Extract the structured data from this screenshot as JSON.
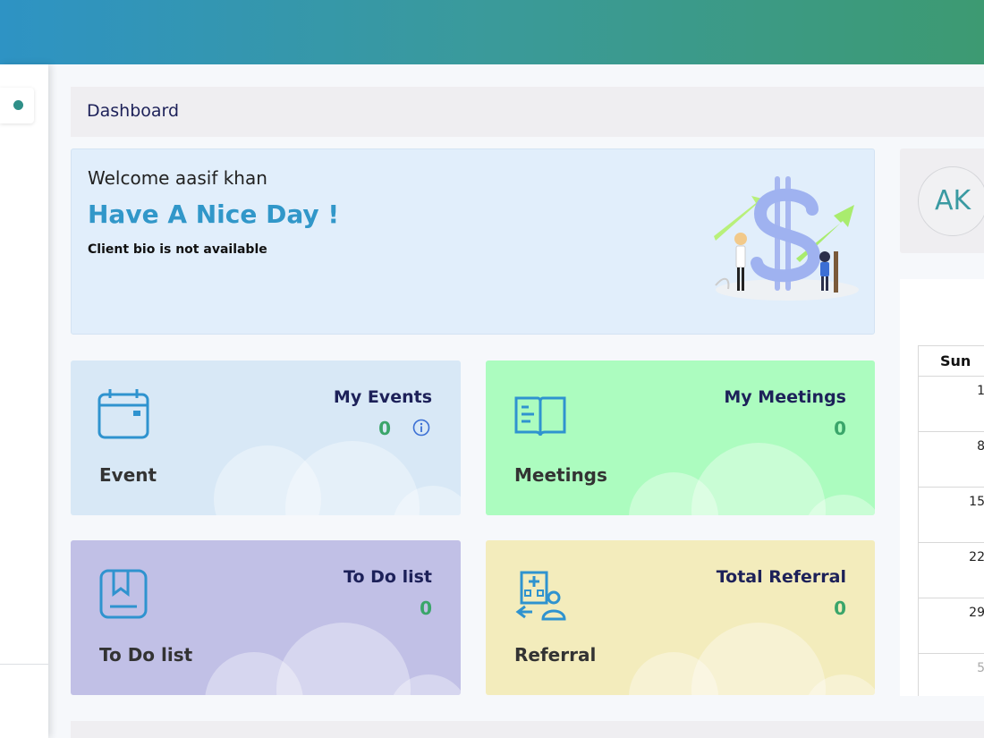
{
  "header": {
    "gradient_start": "#2e93c4",
    "gradient_end": "#3d9a72"
  },
  "breadcrumb": {
    "title": "Dashboard"
  },
  "welcome": {
    "greeting": "Welcome aasif khan",
    "headline": "Have A Nice Day !",
    "bio": "Client bio is not available",
    "illustration_icon": "finance-growth-illustration"
  },
  "cards": {
    "events": {
      "title": "My Events",
      "count": "0",
      "label": "Event",
      "icon": "calendar-icon",
      "bg": "#d8e8f6"
    },
    "meetings": {
      "title": "My Meetings",
      "count": "0",
      "label": "Meetings",
      "icon": "book-icon",
      "bg": "#acfcbf"
    },
    "todo": {
      "title": "To Do list",
      "count": "0",
      "label": "To Do list",
      "icon": "bookmark-book-icon",
      "bg": "#c1c0e6"
    },
    "referral": {
      "title": "Total Referral",
      "count": "0",
      "label": "Referral",
      "icon": "hospital-person-icon",
      "bg": "#f3ecbc"
    }
  },
  "profile": {
    "initials": "AK"
  },
  "calendar": {
    "day_header": "Sun",
    "days": [
      "1",
      "8",
      "15",
      "22",
      "29",
      "5"
    ]
  }
}
